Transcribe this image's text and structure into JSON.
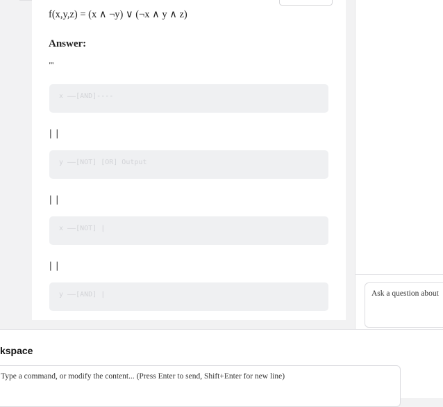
{
  "document": {
    "formula": "f(x,y,z) = (x ∧ ¬y) ∨ (¬x ∧ y ∧ z)",
    "answer_label": "Answer:",
    "code_fence": "'''",
    "code_lines": [
      "x ——[AND]----",
      "y ——[NOT] [OR] Output",
      "x ——[NOT] |",
      "y ——[AND] |"
    ],
    "pipe_lines": [
      "| |",
      "| |",
      "| |"
    ]
  },
  "right_panel": {
    "ask_placeholder": "Ask a question about"
  },
  "bottom": {
    "section_title": "Workspace",
    "command_placeholder": "Type a command, or modify the content... (Press Enter to send, Shift+Enter for new line)"
  }
}
